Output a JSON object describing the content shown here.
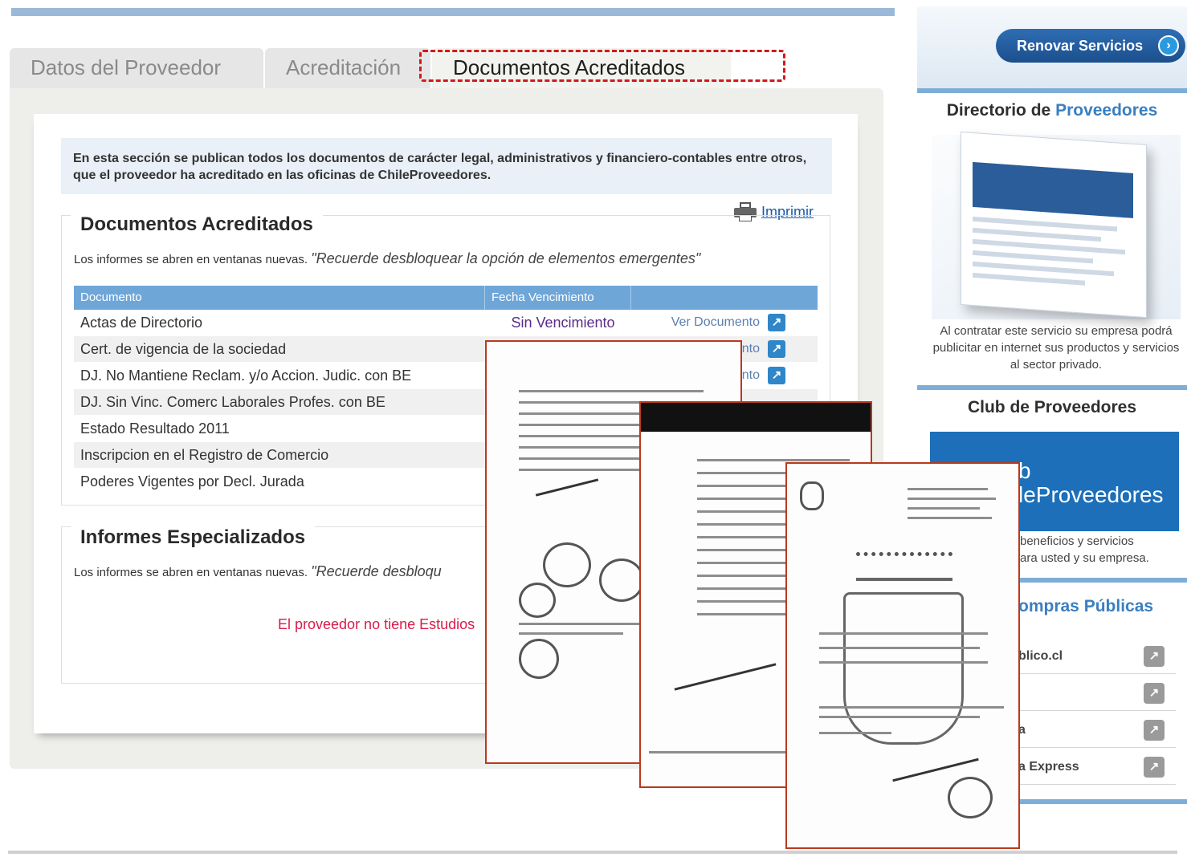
{
  "tabs": [
    {
      "label": "Datos del Proveedor"
    },
    {
      "label": "Acreditación"
    },
    {
      "label": "Documentos Acreditados",
      "active": true
    }
  ],
  "info_text": "En esta sección se publican todos los documentos de carácter legal, administrativos y financiero-contables entre otros, que el proveedor ha acreditado en las oficinas de ChileProveedores.",
  "print_label": "Imprimir",
  "section_docs": {
    "title": "Documentos Acreditados",
    "note_prefix": "Los informes se abren en ventanas nuevas.",
    "note_quote": "\"Recuerde desbloquear la opción de elementos emergentes\"",
    "columns": [
      "Documento",
      "Fecha Vencimiento",
      ""
    ],
    "rows": [
      {
        "name": "Actas de Directorio",
        "expiry": "Sin Vencimiento",
        "action": "Ver Documento"
      },
      {
        "name": "Cert. de vigencia de la sociedad",
        "expiry": "",
        "action": "nto"
      },
      {
        "name": "DJ. No Mantiene Reclam. y/o Accion. Judic. con BE",
        "expiry": "",
        "action": "nto"
      },
      {
        "name": "DJ. Sin Vinc. Comerc Laborales Profes. con BE",
        "expiry": "",
        "action": ""
      },
      {
        "name": "Estado Resultado 2011",
        "expiry": "",
        "action": ""
      },
      {
        "name": "Inscripcion en el Registro de Comercio",
        "expiry": "",
        "action": ""
      },
      {
        "name": "Poderes Vigentes por Decl. Jurada",
        "expiry": "",
        "action": ""
      }
    ]
  },
  "section_reports": {
    "title": "Informes Especializados",
    "note_prefix": "Los informes se abren en ventanas nuevas.",
    "note_quote": "\"Recuerde desbloqu",
    "empty_message": "El proveedor no tiene Estudios"
  },
  "sidebar": {
    "renew_button": "Renovar Servicios",
    "directory_title_a": "Directorio de ",
    "directory_title_b": "Proveedores",
    "directory_text": "Al contratar este servicio su empresa podrá publicitar en internet sus productos y servicios al sector privado.",
    "club_title": "Club de Proveedores",
    "club_banner_line1": "b",
    "club_banner_line2": "leProveedores",
    "club_text_line1": "beneficios y servicios",
    "club_text_line2": "ara usted y su empresa.",
    "public_title": "ompras Públicas",
    "links": [
      "blico.cl",
      "",
      "a",
      "a Express"
    ]
  },
  "colors": {
    "accent": "#3a7fc1",
    "tab_highlight_border": "#d01a1a",
    "table_header": "#6fa6d8",
    "expiry_text": "#5a2b8c",
    "empty_message": "#d81b4a"
  }
}
